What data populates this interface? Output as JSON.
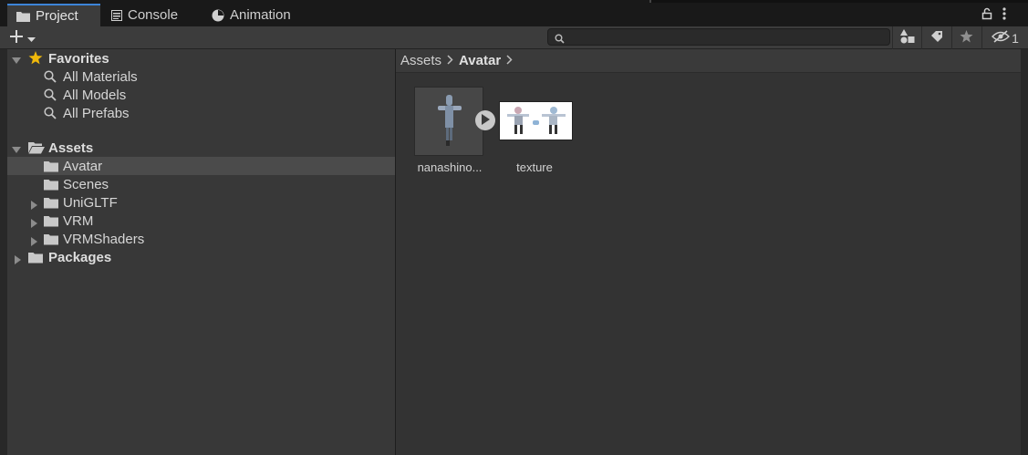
{
  "tabs": [
    {
      "label": "Project",
      "icon": "folder-icon",
      "active": true
    },
    {
      "label": "Console",
      "icon": "console-icon",
      "active": false
    },
    {
      "label": "Animation",
      "icon": "animation-icon",
      "active": false
    }
  ],
  "toolbar": {
    "add_label": "+",
    "search_value": "",
    "hidden_count": "1"
  },
  "favorites": {
    "label": "Favorites",
    "items": [
      {
        "label": "All Materials"
      },
      {
        "label": "All Models"
      },
      {
        "label": "All Prefabs"
      }
    ]
  },
  "assets_tree": {
    "label": "Assets",
    "children": [
      {
        "label": "Avatar",
        "selected": true,
        "expandable": false
      },
      {
        "label": "Scenes",
        "selected": false,
        "expandable": false
      },
      {
        "label": "UniGLTF",
        "selected": false,
        "expandable": true
      },
      {
        "label": "VRM",
        "selected": false,
        "expandable": true
      },
      {
        "label": "VRMShaders",
        "selected": false,
        "expandable": true
      }
    ]
  },
  "packages": {
    "label": "Packages"
  },
  "breadcrumb": [
    "Assets",
    "Avatar"
  ],
  "assets": [
    {
      "label": "nanashino...",
      "kind": "model"
    },
    {
      "label": "texture",
      "kind": "texture"
    }
  ],
  "colors": {
    "accent": "#3d84d8",
    "selected_row": "#4b4b4b",
    "panel": "#383838",
    "star": "#f0b90b"
  }
}
